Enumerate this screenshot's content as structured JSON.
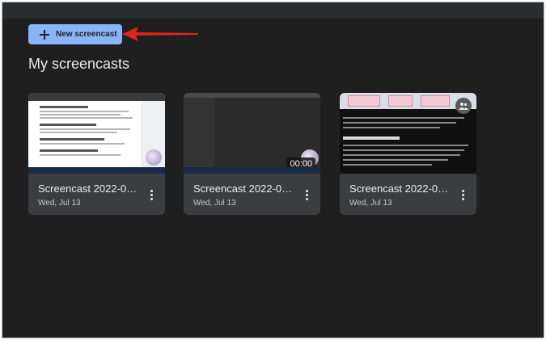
{
  "toolbar": {
    "new_screencast_label": "New screencast"
  },
  "section": {
    "title": "My screencasts"
  },
  "screencasts": [
    {
      "title": "Screencast 2022-0…",
      "date": "Wed, Jul 13",
      "duration": ""
    },
    {
      "title": "Screencast 2022-0…",
      "date": "Wed, Jul 13",
      "duration": "00:00"
    },
    {
      "title": "Screencast 2022-0…",
      "date": "Wed, Jul 13",
      "duration": ""
    }
  ],
  "colors": {
    "background": "#1f1f1f",
    "card": "#3c3d40",
    "accent_button": "#8ab4f8",
    "annotation_arrow": "#e0241b"
  },
  "icons": {
    "new_button": "plus-icon",
    "card_menu": "more-vertical-icon",
    "shared": "people-icon"
  }
}
